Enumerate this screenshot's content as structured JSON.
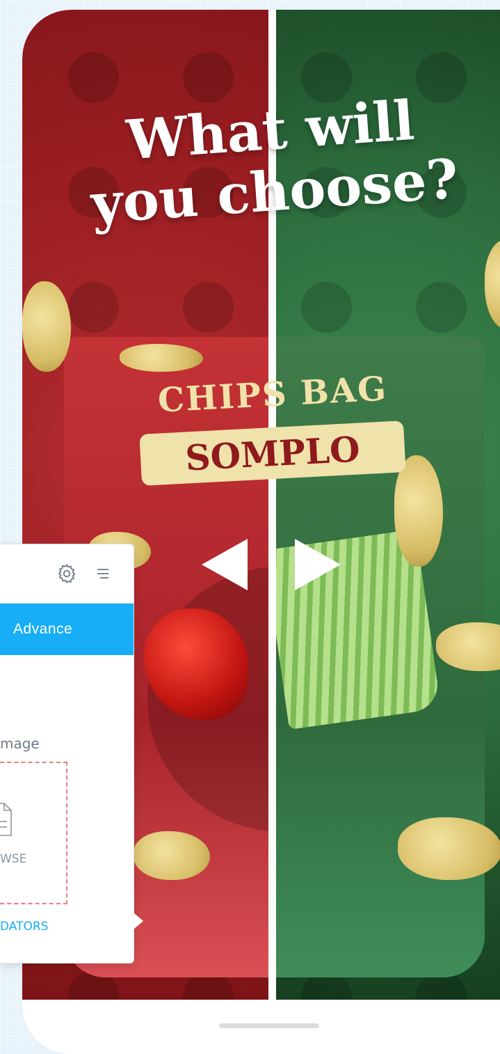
{
  "creative": {
    "headline_line1": "What will",
    "headline_line2": "you choose?",
    "bag_title": "CHIPS BAG",
    "bag_badge": "SOMPLO",
    "colors": {
      "left_side": "#9b1e22",
      "right_side": "#2b6b3c",
      "divider": "#ffffff"
    }
  },
  "navigation": {
    "prev_icon": "triangle-left-icon",
    "next_icon": "triangle-right-icon"
  },
  "editor_panel": {
    "settings_icon": "gear-icon",
    "menu_icon": "hamburger-menu-icon",
    "active_tab_label": "Advance",
    "field_label": "mage",
    "upload_icon": "file-icon",
    "browse_label": "WSE",
    "validators_label": "DATORS",
    "accent_color": "#17aef5",
    "dashed_border_color": "#f07a7a"
  }
}
